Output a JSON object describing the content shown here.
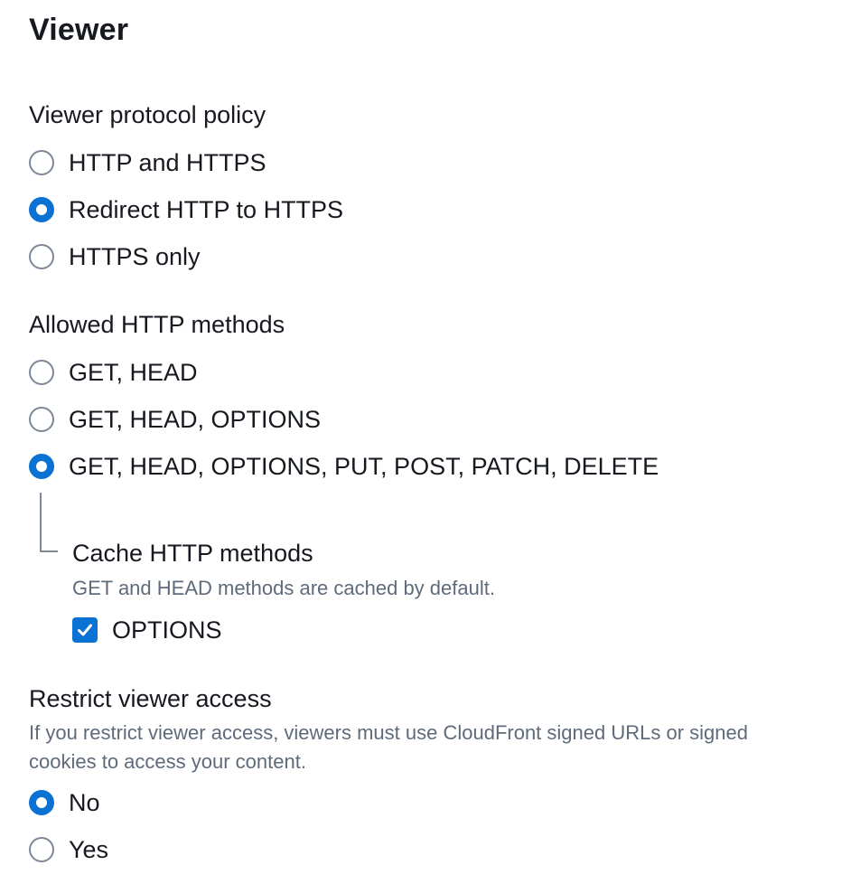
{
  "viewer": {
    "title": "Viewer",
    "protocol_policy": {
      "label": "Viewer protocol policy",
      "options": [
        {
          "label": "HTTP and HTTPS",
          "selected": false
        },
        {
          "label": "Redirect HTTP to HTTPS",
          "selected": true
        },
        {
          "label": "HTTPS only",
          "selected": false
        }
      ]
    },
    "allowed_methods": {
      "label": "Allowed HTTP methods",
      "options": [
        {
          "label": "GET, HEAD",
          "selected": false
        },
        {
          "label": "GET, HEAD, OPTIONS",
          "selected": false
        },
        {
          "label": "GET, HEAD, OPTIONS, PUT, POST, PATCH, DELETE",
          "selected": true
        }
      ]
    },
    "cache_methods": {
      "label": "Cache HTTP methods",
      "description": "GET and HEAD methods are cached by default.",
      "option_label": "OPTIONS",
      "option_checked": true
    },
    "restrict_access": {
      "label": "Restrict viewer access",
      "description_line1": "If you restrict viewer access, viewers must use CloudFront signed URLs or signed",
      "description_line2": "cookies to access your content.",
      "options": [
        {
          "label": "No",
          "selected": true
        },
        {
          "label": "Yes",
          "selected": false
        }
      ]
    }
  },
  "colors": {
    "accent": "#0972d3",
    "text": "#16191f",
    "secondary_text": "#5f6b7a",
    "radio_border": "#7d8998"
  }
}
